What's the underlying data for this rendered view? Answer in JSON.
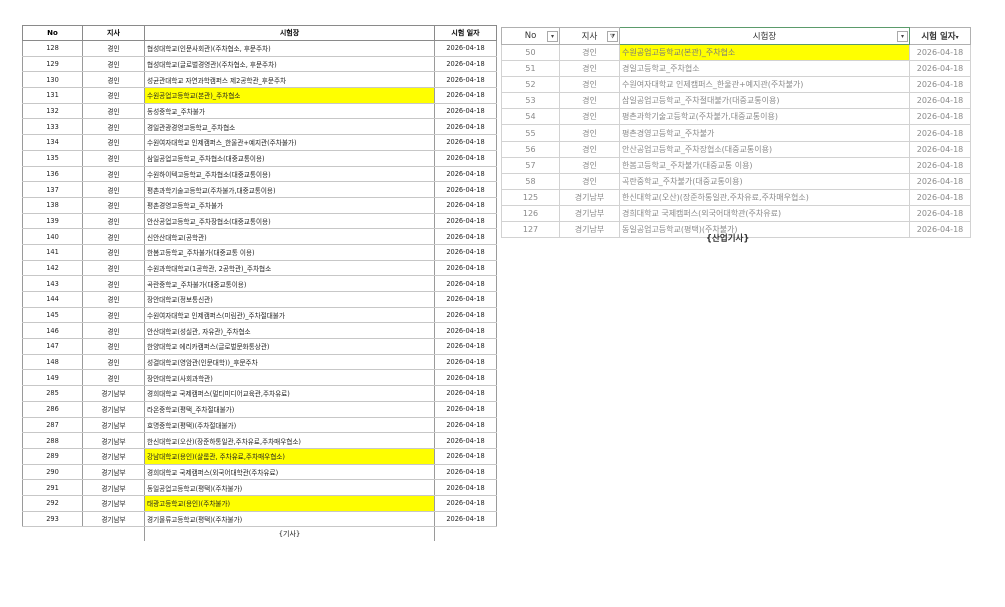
{
  "left_table": {
    "headers": {
      "no": "No",
      "branch": "지사",
      "venue": "시험장",
      "date": "시험 일자"
    },
    "rows": [
      {
        "no": "128",
        "branch": "경인",
        "venue": "협성대학교(인문사회관)(주차협소, 후문주차)",
        "date": "2026-04-18",
        "highlight": false
      },
      {
        "no": "129",
        "branch": "경인",
        "venue": "협성대학교(글로벌경영관)(주차협소, 후문주차)",
        "date": "2026-04-18",
        "highlight": false
      },
      {
        "no": "130",
        "branch": "경인",
        "venue": "성균관대학교 자연과학캠퍼스 제2공학관_후문주차",
        "date": "2026-04-18",
        "highlight": false
      },
      {
        "no": "131",
        "branch": "경인",
        "venue": "수원공업고등학교(본관)_주차협소",
        "date": "2026-04-18",
        "highlight": true
      },
      {
        "no": "132",
        "branch": "경인",
        "venue": "동성중학교_주차불가",
        "date": "2026-04-18",
        "highlight": false
      },
      {
        "no": "133",
        "branch": "경인",
        "venue": "경일관광경영고등학교_주차협소",
        "date": "2026-04-18",
        "highlight": false
      },
      {
        "no": "134",
        "branch": "경인",
        "venue": "수원여자대학교 인제캠퍼스_한울관+예지관(주차불가)",
        "date": "2026-04-18",
        "highlight": false
      },
      {
        "no": "135",
        "branch": "경인",
        "venue": "삼일공업고등학교_주차협소(대중교통이용)",
        "date": "2026-04-18",
        "highlight": false
      },
      {
        "no": "136",
        "branch": "경인",
        "venue": "수원하이텍고등학교_주차협소(대중교통이용)",
        "date": "2026-04-18",
        "highlight": false
      },
      {
        "no": "137",
        "branch": "경인",
        "venue": "평촌과학기술고등학교(주차불가,대중교통이용)",
        "date": "2026-04-18",
        "highlight": false
      },
      {
        "no": "138",
        "branch": "경인",
        "venue": "평촌경영고등학교_주차불가",
        "date": "2026-04-18",
        "highlight": false
      },
      {
        "no": "139",
        "branch": "경인",
        "venue": "안산공업고등학교_주차장협소(대중교통이용)",
        "date": "2026-04-18",
        "highlight": false
      },
      {
        "no": "140",
        "branch": "경인",
        "venue": "신안산대학교(공학관)",
        "date": "2026-04-18",
        "highlight": false
      },
      {
        "no": "141",
        "branch": "경인",
        "venue": "한봄고등학교_주차불가(대중교통 이용)",
        "date": "2026-04-18",
        "highlight": false
      },
      {
        "no": "142",
        "branch": "경인",
        "venue": "수원과학대학교(1공학관, 2공학관)_주차협소",
        "date": "2026-04-18",
        "highlight": false
      },
      {
        "no": "143",
        "branch": "경인",
        "venue": "곡란중학교_주차불가(대중교통이용)",
        "date": "2026-04-18",
        "highlight": false
      },
      {
        "no": "144",
        "branch": "경인",
        "venue": "장안대학교(정보통신관)",
        "date": "2026-04-18",
        "highlight": false
      },
      {
        "no": "145",
        "branch": "경인",
        "venue": "수원여자대학교 인제캠퍼스(미림관)_주차절대불가",
        "date": "2026-04-18",
        "highlight": false
      },
      {
        "no": "146",
        "branch": "경인",
        "venue": "안산대학교(성실관, 자유관)_주차협소",
        "date": "2026-04-18",
        "highlight": false
      },
      {
        "no": "147",
        "branch": "경인",
        "venue": "한양대학교 에리카캠퍼스(글로벌문화통상관)",
        "date": "2026-04-18",
        "highlight": false
      },
      {
        "no": "148",
        "branch": "경인",
        "venue": "성결대학교(영암관(인문대학))_후문주차",
        "date": "2026-04-18",
        "highlight": false
      },
      {
        "no": "149",
        "branch": "경인",
        "venue": "장안대학교(사회과학관)",
        "date": "2026-04-18",
        "highlight": false
      },
      {
        "no": "285",
        "branch": "경기남부",
        "venue": "경희대학교 국제캠퍼스(멀티미디어교육관,주차유료)",
        "date": "2026-04-18",
        "highlight": false
      },
      {
        "no": "286",
        "branch": "경기남부",
        "venue": "라온중학교(평택_주차절대불가)",
        "date": "2026-04-18",
        "highlight": false
      },
      {
        "no": "287",
        "branch": "경기남부",
        "venue": "효명중학교(평택)(주차절대불가)",
        "date": "2026-04-18",
        "highlight": false
      },
      {
        "no": "288",
        "branch": "경기남부",
        "venue": "한신대학교(오산)(장준하통일관,주차유료,주차매우협소)",
        "date": "2026-04-18",
        "highlight": false
      },
      {
        "no": "289",
        "branch": "경기남부",
        "venue": "강남대학교(용인)(샬롬관, 주차유료,주차매우협소)",
        "date": "2026-04-18",
        "highlight": true
      },
      {
        "no": "290",
        "branch": "경기남부",
        "venue": "경희대학교 국제캠퍼스(외국어대학관(주차유료)",
        "date": "2026-04-18",
        "highlight": false
      },
      {
        "no": "291",
        "branch": "경기남부",
        "venue": "동일공업고등학교(평택)(주차불가)",
        "date": "2026-04-18",
        "highlight": false
      },
      {
        "no": "292",
        "branch": "경기남부",
        "venue": "태광고등학교(용인)(주차불가)",
        "date": "2026-04-18",
        "highlight": true
      },
      {
        "no": "293",
        "branch": "경기남부",
        "venue": "경기물류고등학교(평택)(주차불가)",
        "date": "2026-04-18",
        "highlight": false
      }
    ],
    "caption": "{기사}"
  },
  "right_table": {
    "headers": {
      "no": "No",
      "branch": "지사",
      "venue": "시험장",
      "date": "시험 일자"
    },
    "rows": [
      {
        "no": "50",
        "branch": "경인",
        "venue": "수원공업고등학교(본관)_주차협소",
        "date": "2026-04-18",
        "highlight": true
      },
      {
        "no": "51",
        "branch": "경인",
        "venue": "경일고등학교_주차협소",
        "date": "2026-04-18",
        "highlight": false
      },
      {
        "no": "52",
        "branch": "경인",
        "venue": "수원여자대학교 인제캠퍼스_한울관+예지관(주차불가)",
        "date": "2026-04-18",
        "highlight": false
      },
      {
        "no": "53",
        "branch": "경인",
        "venue": "삼일공업고등학교_주차절대불가(대중교통이용)",
        "date": "2026-04-18",
        "highlight": false
      },
      {
        "no": "54",
        "branch": "경인",
        "venue": "평촌과학기술고등학교(주차불가,대중교통이용)",
        "date": "2026-04-18",
        "highlight": false
      },
      {
        "no": "55",
        "branch": "경인",
        "venue": "평촌경영고등학교_주차불가",
        "date": "2026-04-18",
        "highlight": false
      },
      {
        "no": "56",
        "branch": "경인",
        "venue": "안산공업고등학교_주차장협소(대중교통이용)",
        "date": "2026-04-18",
        "highlight": false
      },
      {
        "no": "57",
        "branch": "경인",
        "venue": "한봄고등학교_주차불가(대중교통 이용)",
        "date": "2026-04-18",
        "highlight": false
      },
      {
        "no": "58",
        "branch": "경인",
        "venue": "곡란중학교_주차불가(대중교통이용)",
        "date": "2026-04-18",
        "highlight": false
      },
      {
        "no": "125",
        "branch": "경기남부",
        "venue": "한신대학교(오산)(장준하통일관,주차유료,주차매우협소)",
        "date": "2026-04-18",
        "highlight": false
      },
      {
        "no": "126",
        "branch": "경기남부",
        "venue": "경희대학교 국제캠퍼스(외국어대학관(주차유료)",
        "date": "2026-04-18",
        "highlight": false
      },
      {
        "no": "127",
        "branch": "경기남부",
        "venue": "동일공업고등학교(평택)(주차불가)",
        "date": "2026-04-18",
        "highlight": false
      }
    ],
    "caption": "{산업기사}"
  },
  "icons": {
    "dropdown": "dropdown-arrow-icon",
    "filter": "filter-icon"
  },
  "colors": {
    "highlight": "#ffff00",
    "header_selected_border": "#5b9b6b",
    "grid": "#c7c7c7"
  }
}
